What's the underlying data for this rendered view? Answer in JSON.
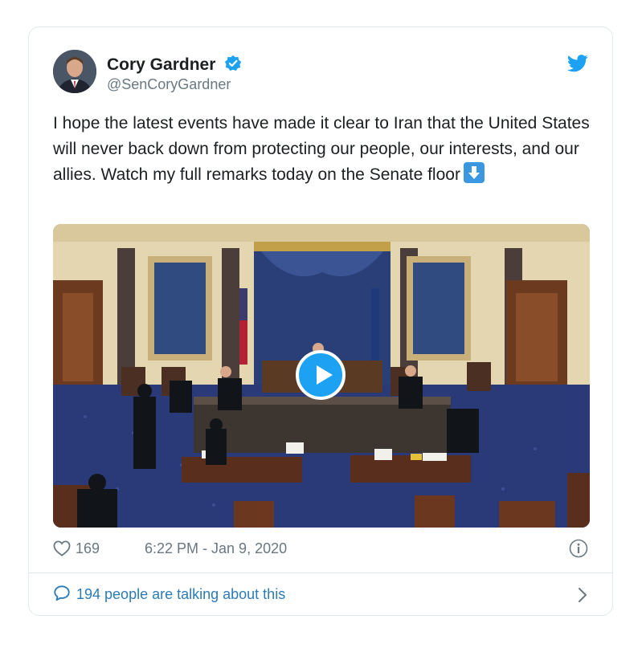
{
  "tweet": {
    "display_name": "Cory Gardner",
    "handle": "@SenCoryGardner",
    "verified_icon": "verified-badge-icon",
    "brand_icon": "twitter-bird-icon",
    "text": "I hope the latest events have made it clear to Iran that the United States will never back down from protecting our people, our interests, and our allies. Watch my full remarks today on the Senate floor",
    "emoji": "down-arrow-emoji",
    "media": {
      "type": "video",
      "play_icon": "play-icon"
    },
    "likes": "169",
    "timestamp": "6:22 PM - Jan 9, 2020",
    "info_icon": "info-icon",
    "conversation": "194 people are talking about this"
  },
  "colors": {
    "accent": "#1da1f2",
    "link": "#2b7bb9",
    "muted": "#697882",
    "border": "#e1e8ed"
  }
}
